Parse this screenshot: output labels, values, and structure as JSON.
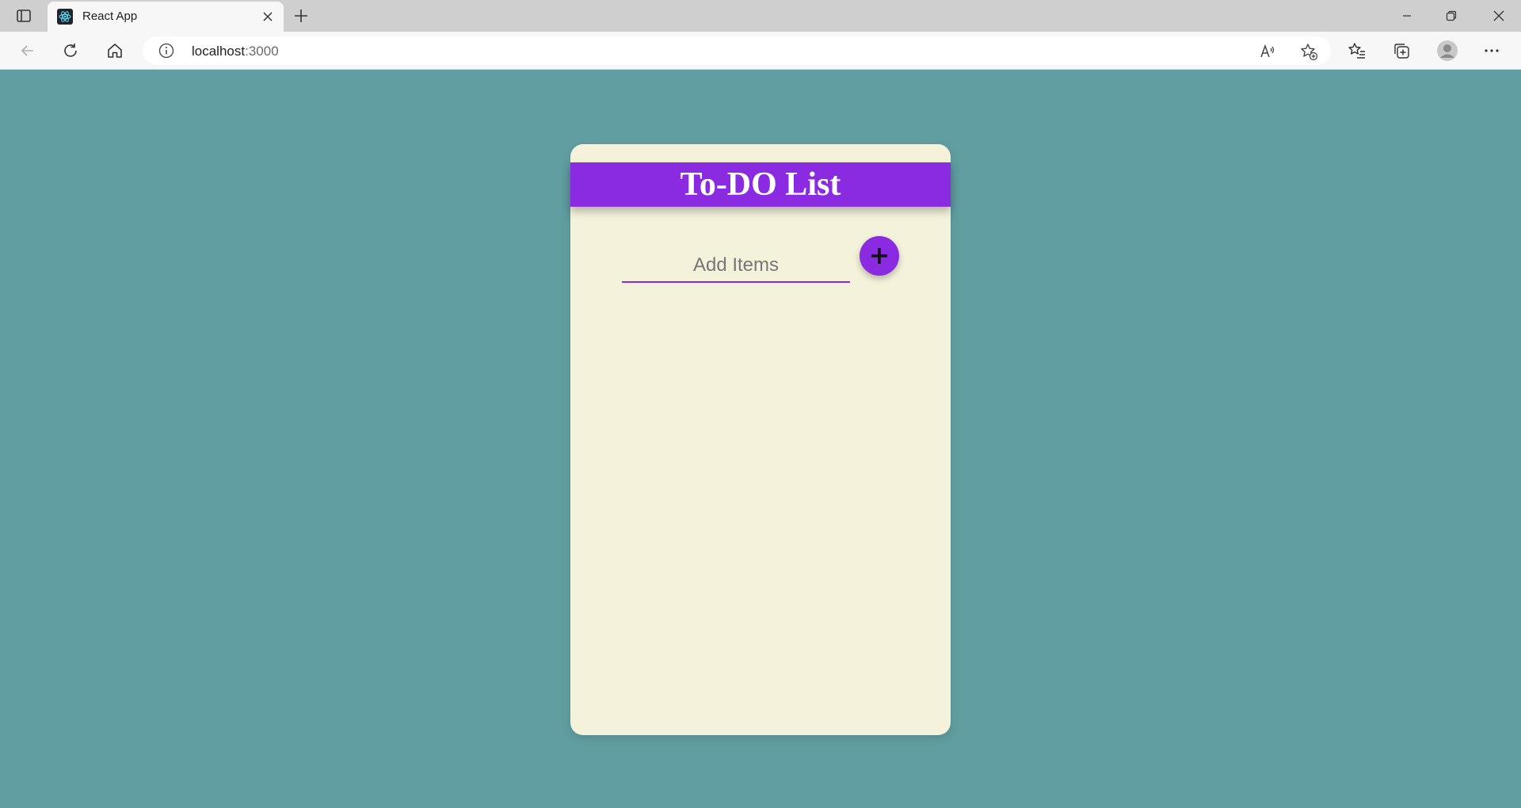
{
  "browser": {
    "tab": {
      "title": "React App",
      "favicon": "react-icon"
    },
    "address": {
      "host": "localhost",
      "port": ":3000"
    },
    "icons": {
      "tab_actions": "tab-actions-icon",
      "new_tab": "plus-icon",
      "back": "back-arrow-icon",
      "reload": "reload-icon",
      "home": "home-icon",
      "info": "info-icon",
      "read_aloud": "read-aloud-icon",
      "add_favorite": "add-favorite-icon",
      "favorites": "favorites-icon",
      "collections": "collections-icon",
      "profile": "profile-icon",
      "more": "more-icon"
    }
  },
  "app": {
    "title": "To-DO List",
    "input": {
      "placeholder": "Add Items",
      "value": ""
    },
    "add_button_icon": "plus-icon",
    "items": []
  },
  "colors": {
    "page_background": "#609ea2",
    "card_background": "#f4f2db",
    "accent": "#8a2be2"
  }
}
